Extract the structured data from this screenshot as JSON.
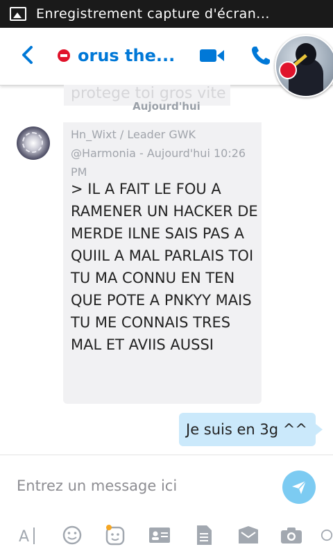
{
  "status_bar": {
    "title": "Enregistrement capture d'écran..."
  },
  "header": {
    "contact_name": "orus the...",
    "presence": "dnd",
    "accent_color": "#0078d7"
  },
  "conversation": {
    "previous_message_fragment": "protege toi gros vite",
    "date_separator": "Aujourd'hui",
    "incoming": {
      "sender_line": "Hn_Wixt / Leader GWK",
      "meta_line": "@Harmonia - Aujourd'hui 10:26 PM",
      "text": "> IL A FAIT LE FOU A RAMENER UN HACKER DE MERDE ILNE SAIS PAS A QUIIL A MAL PARLAIS TOI TU MA CONNU EN TEN QUE POTE A PNKYY MAIS TU ME CONNAIS TRES MAL ET AVIIS AUSSI"
    },
    "outgoing": {
      "text": "Je suis en 3g ^^"
    }
  },
  "composer": {
    "placeholder": "Entrez un message ici"
  },
  "toolbar": {
    "items": [
      "text-format-icon",
      "emoticon-icon",
      "moji-icon",
      "contact-card-icon",
      "file-icon",
      "send-money-icon",
      "camera-icon",
      "more-icon"
    ]
  },
  "colors": {
    "incoming_bubble": "#f1f1f3",
    "outgoing_bubble": "#cbe9fb",
    "send_button": "#7ccbf2",
    "presence_red": "#e0132b"
  }
}
